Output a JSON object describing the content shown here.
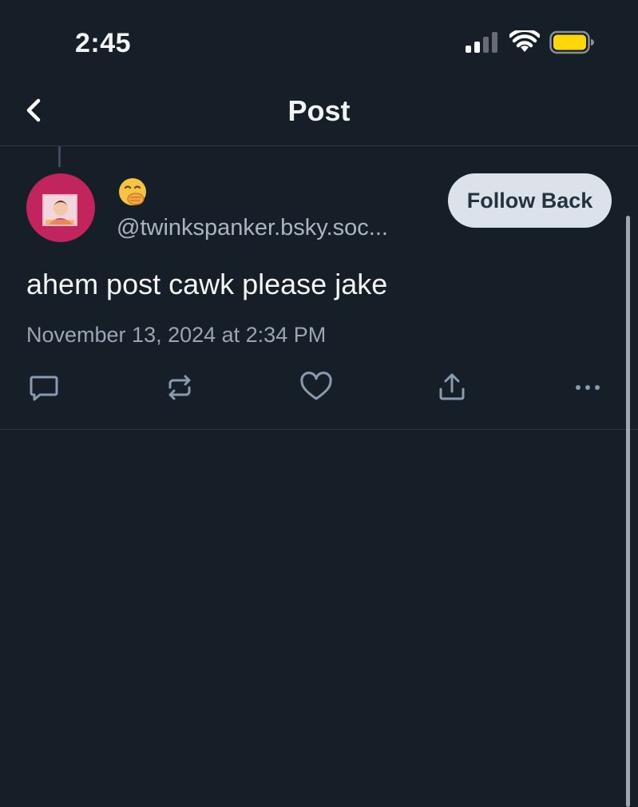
{
  "status_bar": {
    "time": "2:45",
    "icons": [
      "signal-icon",
      "wifi-icon",
      "battery-icon"
    ],
    "battery_color": "#ffd60a"
  },
  "nav": {
    "title": "Post",
    "back_icon": "chevron-left-icon"
  },
  "post": {
    "author": {
      "display_name": "🤭",
      "handle": "@twinkspanker.bsky.soc...",
      "avatar_color": "#c2245e"
    },
    "follow_label": "Follow Back",
    "text": "ahem post cawk please jake",
    "date": "November 13, 2024 at 2:34 PM",
    "actions": [
      "reply-icon",
      "repost-icon",
      "like-icon",
      "share-icon",
      "more-icon"
    ]
  },
  "colors": {
    "background": "#161e27",
    "icon": "#8a9bb0",
    "divider": "#2b3643"
  }
}
